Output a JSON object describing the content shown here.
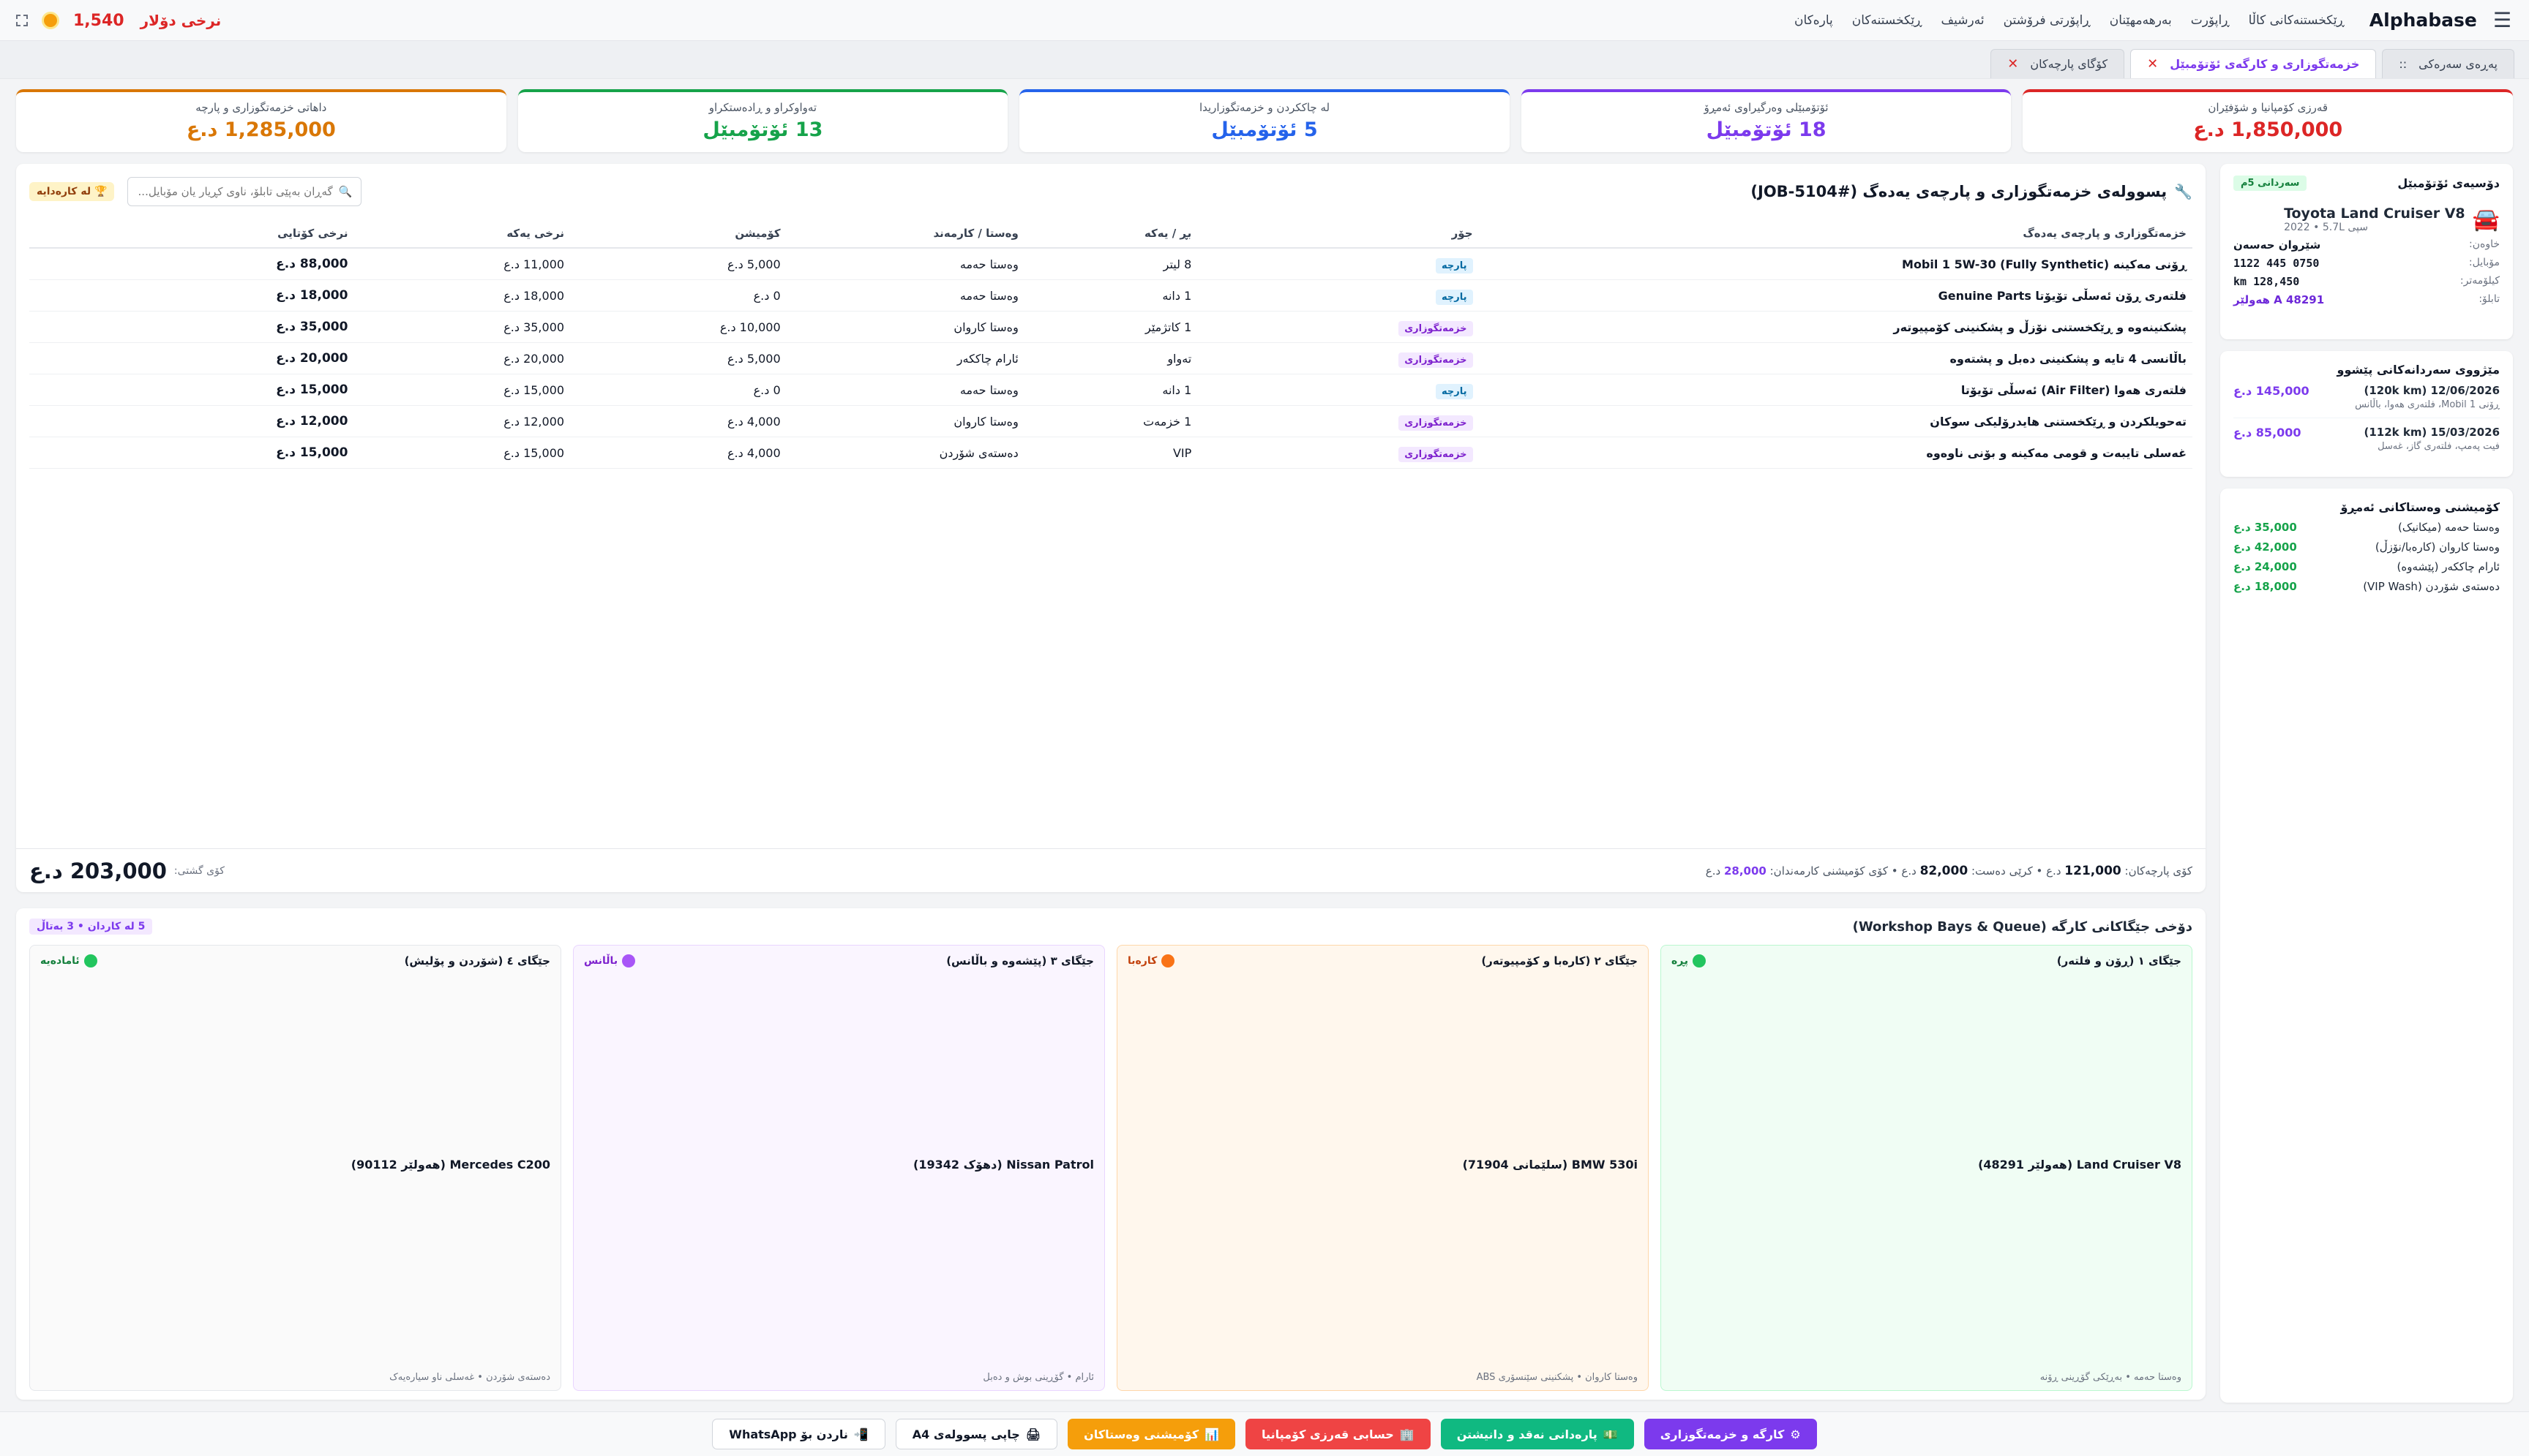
{
  "nav": {
    "brand": "Alphabase",
    "menu": [
      "ڕێکخستنەکانی کاڵا",
      "ڕاپۆرت",
      "بەرهەمهێنان",
      "ڕاپۆرتی فرۆشتن",
      "ئەرشیف",
      "ڕێکخستنەکان",
      "پارەکان"
    ],
    "rate_label": "نرخی دۆلار",
    "rate_value": "1,540"
  },
  "tabs": [
    {
      "label": "پەڕەی سەرەکی",
      "active": false,
      "closable": false,
      "prefix": "::"
    },
    {
      "label": "خزمەتگوزاری و کارگەی ئۆتۆمبێل",
      "active": true,
      "closable": true
    },
    {
      "label": "کۆگای پارچەکان",
      "active": false,
      "closable": true
    }
  ],
  "kpis": [
    {
      "label": "قەرزی کۆمپانیا و شۆفێران",
      "value": "1,850,000 د.ع",
      "color": "#dc2626"
    },
    {
      "label": "ئۆتۆمبێلی وەرگیراوی ئەمڕۆ",
      "value": "18 ئۆتۆمبێل",
      "color": "#7c3aed"
    },
    {
      "label": "لە چاککردن و خزمەتگوزاریدا",
      "value": "5 ئۆتۆمبێل",
      "color": "#2563eb"
    },
    {
      "label": "تەواوکراو و ڕادەستکراو",
      "value": "13 ئۆتۆمبێل",
      "color": "#16a34a"
    },
    {
      "label": "داهاتی خزمەتگوزاری و پارچە",
      "value": "1,285,000 د.ع",
      "color": "#d97706"
    }
  ],
  "job": {
    "title": "پسوولەی خزمەتگوزاری و پارچەی یەدەگ (JOB-5104#)",
    "search_placeholder": "گەڕان بەپێی تابلۆ، ناوی کڕیار یان مۆبایل...",
    "cup_badge": "لە کارەدایە",
    "columns": [
      "خزمەتگوزاری و پارچەی یەدەگ",
      "جۆر",
      "بڕ / یەکە",
      "وەستا / کارمەند",
      "کۆمیشن",
      "نرخی یەکە",
      "نرخی کۆتایی"
    ],
    "rows": [
      {
        "name": "ڕۆنی مەکینە Mobil 1 5W-30 (Fully Synthetic)",
        "type": "پارچە",
        "kind": "part",
        "qty": "8 لیتر",
        "staff": "وەستا حەمە",
        "commission": "5,000 د.ع",
        "unit": "11,000 د.ع",
        "total": "88,000 د.ع"
      },
      {
        "name": "فلتەری ڕۆن ئەسڵی تۆیۆتا Genuine Parts",
        "type": "پارچە",
        "kind": "part",
        "qty": "1 دانە",
        "staff": "وەستا حەمە",
        "commission": "0 د.ع",
        "unit": "18,000 د.ع",
        "total": "18,000 د.ع"
      },
      {
        "name": "پشکنینەوە و ڕێکخستنی نۆزڵ و پشکنینی کۆمپیوتەر",
        "type": "خزمەتگوزاری",
        "kind": "service",
        "qty": "1 کاتژمێر",
        "staff": "وەستا کاروان",
        "commission": "10,000 د.ع",
        "unit": "35,000 د.ع",
        "total": "35,000 د.ع"
      },
      {
        "name": "باڵانسی 4 تایە و پشکنینی دەبل و پشتەوە",
        "type": "خزمەتگوزاری",
        "kind": "service",
        "qty": "تەواو",
        "staff": "ئارام چاککەر",
        "commission": "5,000 د.ع",
        "unit": "20,000 د.ع",
        "total": "20,000 د.ع"
      },
      {
        "name": "فلتەری هەوا (Air Filter) ئەسڵی تۆیۆتا",
        "type": "پارچە",
        "kind": "part",
        "qty": "1 دانە",
        "staff": "وەستا حەمە",
        "commission": "0 د.ع",
        "unit": "15,000 د.ع",
        "total": "15,000 د.ع"
      },
      {
        "name": "تەحویلکردن و ڕێکخستنی هایدرۆلیکی سوکان",
        "type": "خزمەتگوزاری",
        "kind": "service",
        "qty": "1 خزمەت",
        "staff": "وەستا کاروان",
        "commission": "4,000 د.ع",
        "unit": "12,000 د.ع",
        "total": "12,000 د.ع"
      },
      {
        "name": "غەسلی تایبەت و قومی مەکینە و بۆنی ناوەوە",
        "type": "خزمەتگوزاری",
        "kind": "service",
        "qty": "VIP",
        "staff": "دەستەی شۆردن",
        "commission": "4,000 د.ع",
        "unit": "15,000 د.ع",
        "total": "15,000 د.ع"
      }
    ],
    "footer": {
      "parts_label": "کۆی پارچەکان:",
      "parts_value": "121,000",
      "labor_label": "کرێی دەست:",
      "labor_value": "82,000",
      "commission_label": "کۆی کۆمیشنی کارمەندان:",
      "commission_value": "28,000",
      "currency": "د.ع",
      "grand_label": "کۆی گشتی:",
      "grand_value": "203,000 د.ع"
    }
  },
  "vehicle": {
    "title": "دۆسیەی ئۆتۆمبێل",
    "badge": "سەردانی 5م",
    "car_name": "Toyota Land Cruiser V8",
    "car_sub": "2022 • 5.7L سپی",
    "owner_label": "خاوەن:",
    "owner": "شێروان حەسەن",
    "mobile_label": "مۆبایل:",
    "mobile": "0750 445 1122",
    "km_label": "کیلۆمەتر:",
    "km": "128,450 km",
    "plate_label": "تابلۆ:",
    "plate": "A 48291 هەولێر"
  },
  "history": {
    "title": "مێژووی سەردانەکانی پێشوو",
    "items": [
      {
        "date": "12/06/2026 (120k km)",
        "note": "ڕۆنی Mobil 1، فلتەری هەوا، باڵانس",
        "price": "145,000 د.ع"
      },
      {
        "date": "15/03/2026 (112k km)",
        "note": "فیت پەمپ، فلتەری گاز، غەسل",
        "price": "85,000 د.ع"
      }
    ]
  },
  "commissions": {
    "title": "کۆمیشنی وەستاکانی ئەمڕۆ",
    "items": [
      {
        "name": "وەستا حەمە (میکانیک)",
        "amount": "35,000 د.ع"
      },
      {
        "name": "وەستا کاروان (کارەبا/نۆزڵ)",
        "amount": "42,000 د.ع"
      },
      {
        "name": "ئارام چاککەر (پێشەوە)",
        "amount": "24,000 د.ع"
      },
      {
        "name": "دەستەی شۆردن (VIP Wash)",
        "amount": "18,000 د.ع"
      }
    ]
  },
  "bays": {
    "title": "دۆخی جێگاکانی کارگە (Workshop Bays & Queue)",
    "queue": "5 لە کاردان • 3 بەتاڵ",
    "items": [
      {
        "name": "جێگای ١ (ڕۆن و فلتەر)",
        "status": "پڕە",
        "dot": "#22c55e",
        "bg": "#f0fdf4",
        "border": "#bbf7d0",
        "status_color": "#15803d",
        "car": "Land Cruiser V8 (هەولێر 48291)",
        "staff": "وەستا حەمە • بەڕێکی گۆڕینی ڕۆنە"
      },
      {
        "name": "جێگای ٢ (کارەبا و کۆمپیوتەر)",
        "status": "کارەبا",
        "dot": "#f97316",
        "bg": "#fff7ed",
        "border": "#fed7aa",
        "status_color": "#c2410c",
        "car": "BMW 530i (سلێمانی 71904)",
        "staff": "وەستا کاروان • پشکنینی سێنسۆری ABS"
      },
      {
        "name": "جێگای ٣ (پێشەوە و باڵانس)",
        "status": "باڵانس",
        "dot": "#a855f7",
        "bg": "#faf5ff",
        "border": "#e9d5ff",
        "status_color": "#7e22ce",
        "car": "Nissan Patrol (دهۆک 19342)",
        "staff": "ئارام • گۆڕینی بوش و دەبل"
      },
      {
        "name": "جێگای ٤ (شۆردن و پۆلیش)",
        "status": "ئامادەیە",
        "dot": "#22c55e",
        "bg": "#fafafa",
        "border": "#e5e7eb",
        "status_color": "#15803d",
        "car": "Mercedes C200 (هەولێر 90112)",
        "staff": "دەستەی شۆردن • غەسلی ناو سیارەیەک"
      }
    ]
  },
  "actions": [
    {
      "label": "کارگە و خزمەتگوزاری",
      "color": "#7c3aed",
      "icon": "⚙"
    },
    {
      "label": "پارەدانی نەقد و دانیشتن",
      "color": "#10b981",
      "icon": "💵"
    },
    {
      "label": "حسابی قەرزی کۆمپانیا",
      "color": "#ef4444",
      "icon": "🏢"
    },
    {
      "label": "کۆمیشنی وەستاکان",
      "color": "#f59e0b",
      "icon": "📊"
    },
    {
      "label": "چاپی پسوولەی A4",
      "color": "",
      "icon": "🖨",
      "outline": true
    },
    {
      "label": "ناردن بۆ WhatsApp",
      "color": "",
      "icon": "📲",
      "outline": true
    }
  ]
}
